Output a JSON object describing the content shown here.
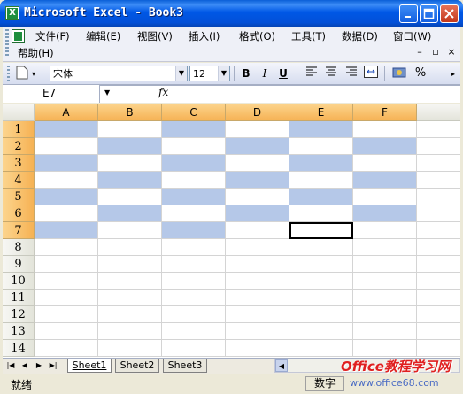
{
  "window": {
    "title": "Microsoft Excel - Book3"
  },
  "menu": {
    "items": [
      {
        "label": "文件(F)"
      },
      {
        "label": "编辑(E)"
      },
      {
        "label": "视图(V)"
      },
      {
        "label": "插入(I)"
      },
      {
        "label": "格式(O)"
      },
      {
        "label": "工具(T)"
      },
      {
        "label": "数据(D)"
      },
      {
        "label": "窗口(W)"
      },
      {
        "label": "帮助(H)"
      }
    ]
  },
  "toolbar": {
    "font_name": "宋体",
    "font_size": "12",
    "bold": "B",
    "italic": "I",
    "underline": "U",
    "percent": "%"
  },
  "formula_bar": {
    "name_box": "E7",
    "fx": "fx"
  },
  "grid": {
    "columns": [
      "A",
      "B",
      "C",
      "D",
      "E",
      "F"
    ],
    "rows": [
      "1",
      "2",
      "3",
      "4",
      "5",
      "6",
      "7",
      "8",
      "9",
      "10",
      "11",
      "12",
      "13",
      "14"
    ],
    "selected_column": "E",
    "active_cell": "E7"
  },
  "sheets": {
    "tabs": [
      "Sheet1",
      "Sheet2",
      "Sheet3"
    ],
    "active": "Sheet1"
  },
  "status": {
    "mode": "就绪",
    "num": "数字"
  },
  "watermark": {
    "line1": "Office教程学习网",
    "line2": "www.office68.com"
  },
  "colors": {
    "header_highlight": "#F6B254",
    "shade": "#B5C8E8",
    "titlebar": "#0058E6"
  }
}
